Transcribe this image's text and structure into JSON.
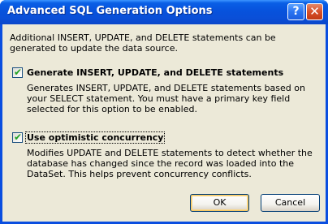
{
  "window": {
    "title": "Advanced SQL Generation Options",
    "help_glyph": "?",
    "close_glyph": "✕"
  },
  "intro_text": "Additional INSERT, UPDATE, and DELETE statements can be generated to update the data source.",
  "options": [
    {
      "label": "Generate INSERT, UPDATE, and DELETE statements",
      "checked": true,
      "description": "Generates INSERT, UPDATE, and DELETE statements based on your SELECT statement. You must have a primary key field selected for this option to be enabled."
    },
    {
      "label": "Use optimistic concurrency",
      "checked": true,
      "description": "Modifies UPDATE and DELETE statements to detect whether the database has changed since the record was loaded into the DataSet. This helps prevent concurrency conflicts."
    }
  ],
  "buttons": {
    "ok": "OK",
    "cancel": "Cancel"
  },
  "check_glyph": "✔",
  "colors": {
    "titlebar": "#0a4ee0",
    "dialog_bg": "#ece9d8",
    "check": "#21a121"
  }
}
